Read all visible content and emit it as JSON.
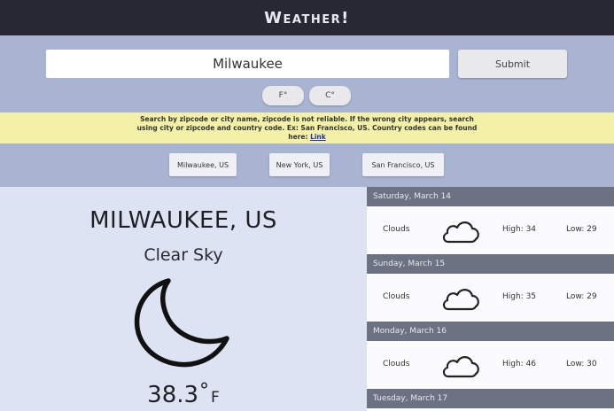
{
  "app": {
    "title": "Weather!"
  },
  "search": {
    "value": "Milwaukee",
    "submit_label": "Submit"
  },
  "units": [
    {
      "label": "F°"
    },
    {
      "label": "C°"
    }
  ],
  "notice": {
    "text": "Search by zipcode or city name, zipcode is not reliable. If the wrong city appears, search using city or zipcode and country code. Ex: San Francisco, US. Country codes can be found here: ",
    "link_label": "Link"
  },
  "quick_cities": [
    {
      "label": "Milwaukee, US"
    },
    {
      "label": "New York, US"
    },
    {
      "label": "San Francisco, US"
    }
  ],
  "current": {
    "city": "MILWAUKEE, US",
    "condition": "Clear Sky",
    "icon": "moon-icon",
    "temp": "38.3",
    "deg": "°",
    "unit": "F"
  },
  "forecast": [
    {
      "date": "Saturday, March 14",
      "condition": "Clouds",
      "icon": "cloud-icon",
      "high": "High: 34",
      "low": "Low: 29"
    },
    {
      "date": "Sunday, March 15",
      "condition": "Clouds",
      "icon": "cloud-icon",
      "high": "High: 35",
      "low": "Low: 29"
    },
    {
      "date": "Monday, March 16",
      "condition": "Clouds",
      "icon": "cloud-icon",
      "high": "High: 46",
      "low": "Low: 30"
    },
    {
      "date": "Tuesday, March 17"
    }
  ]
}
